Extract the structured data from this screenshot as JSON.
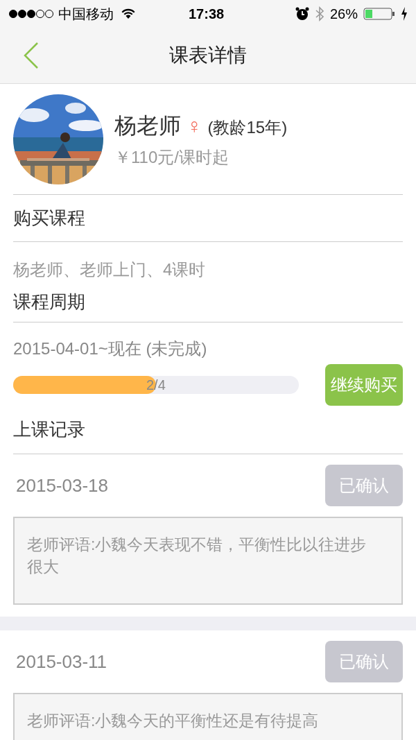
{
  "status_bar": {
    "carrier": "中国移动",
    "time": "17:38",
    "battery": "26%"
  },
  "nav": {
    "title": "课表详情"
  },
  "teacher": {
    "name": "杨老师",
    "gender": "♀",
    "experience": "(教龄15年)",
    "price": "￥110元/课时起"
  },
  "purchase": {
    "heading": "购买课程",
    "detail": "杨老师、老师上门、4课时"
  },
  "period": {
    "heading": "课程周期",
    "range": "2015-04-01~现在 (未完成)",
    "progress_label": "2/4",
    "level": 0.5,
    "button": "继续购买"
  },
  "records": {
    "heading": "上课记录",
    "items": [
      {
        "date": "2015-03-18",
        "status": "已确认",
        "confirmed": true,
        "comment": "老师评语:小魏今天表现不错，平衡性比以往进步很大"
      },
      {
        "date": "2015-03-11",
        "status": "已确认",
        "confirmed": true,
        "comment": "老师评语:小魏今天的平衡性还是有待提高"
      }
    ]
  }
}
